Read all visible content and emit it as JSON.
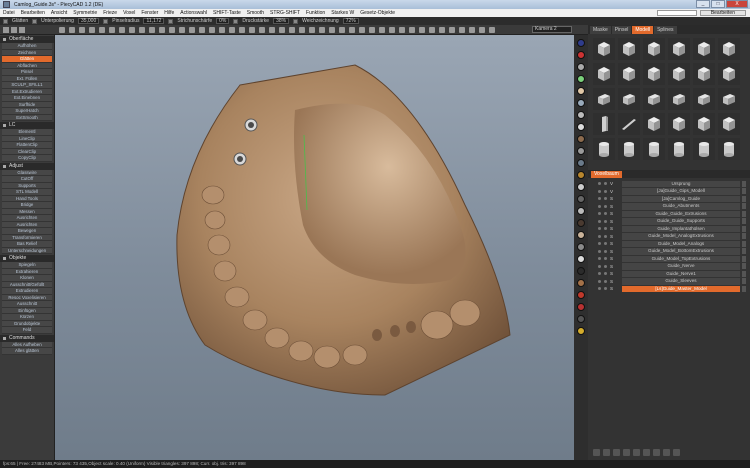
{
  "window": {
    "title": "Camlog_Guide.3s* - PiecyCAD 1.2 (DE)",
    "buttons": [
      "_",
      "□",
      "X"
    ]
  },
  "menubar": {
    "items": [
      "Datei",
      "Bearbeiten",
      "Ansicht",
      "Symmetrie",
      "Frieze",
      "Voxel",
      "Fenster",
      "Hilfe",
      "Actionswahl",
      "SHIFT-Taste",
      "Smooth",
      "STRG-SHIFT",
      "Funktion",
      "Starkes W",
      "Gesetz-Objekte"
    ],
    "right_button": "Bearbeiten"
  },
  "toolbar": {
    "label_left": "Glätten",
    "items": [
      {
        "label": "Unterpolierung",
        "value": "35,000"
      },
      {
        "label": "Pinselradius",
        "value": "11,172"
      },
      {
        "label": "Strichunschärfe",
        "value": "0%"
      },
      {
        "label": "Druckstärke",
        "value": "38%"
      },
      {
        "label": "Weichzeichnung",
        "value": "72%"
      }
    ]
  },
  "viewport": {
    "camera_select": "Kamera 2"
  },
  "left_panel": {
    "sections": [
      {
        "title": "Oberfläche",
        "items": [
          "Aufhöhen",
          "Zeichnen",
          "Glätten",
          "Abflachen",
          "Pinsel",
          "Ext. Füllen",
          "SCULP_SFILL1",
          "Ext.Extrudieren",
          "Ext.Einebnen",
          "Surfhide",
          "SuperHatch",
          "ExtSmooth"
        ],
        "active_index": 2
      },
      {
        "title": "LC",
        "items": [
          "Elementl",
          "LineClip",
          "FlattenClip",
          "ClearClip",
          "CopyClip"
        ]
      },
      {
        "title": "Adjust",
        "items": [
          "Glasswire",
          "CutOff",
          "Supports",
          "STL Modell",
          "Hand Tools",
          "Bridge",
          "Messen",
          "Ausrichten",
          "Ausrichten",
          "Bewegen",
          "Transformieren",
          "Bas Relief",
          "Unterschneidungen"
        ]
      },
      {
        "title": "Objekte",
        "items": [
          "Spiegeln",
          "Extrahieren",
          "Klonen",
          "Ausschnitt/Gefüllt",
          "Extrudieren",
          "Resoc Voxelisieren",
          "Ausschnitt",
          "Einfügen",
          "Kürzen",
          "Grundobjekte",
          "Feld"
        ]
      },
      {
        "title": "Commands",
        "items": [
          "Alles Aufheben",
          "Alles glätten"
        ]
      }
    ]
  },
  "right_panel": {
    "tabs": [
      "Maske",
      "Pinsel",
      "Modell",
      "Splines"
    ],
    "active_tab": 2,
    "scene_header": "Voxelbaum",
    "scene_items": [
      {
        "flag": "V",
        "label": "Ursprung"
      },
      {
        "flag": "V",
        "label": "[Ja]Guide_Gips_Modell"
      },
      {
        "flag": "S",
        "label": "[Ja]Camlog_Guide"
      },
      {
        "flag": "S",
        "label": "Guide_Abutments"
      },
      {
        "flag": "S",
        "label": "Guide_Guide_Extrusions"
      },
      {
        "flag": "S",
        "label": "Guide_Guide_Supports"
      },
      {
        "flag": "S",
        "label": "Guide_Implantathülsen"
      },
      {
        "flag": "S",
        "label": "Guide_Model_AnalogExtrusions"
      },
      {
        "flag": "S",
        "label": "Guide_Model_Analogs"
      },
      {
        "flag": "S",
        "label": "Guide_Model_BottomExtrusions"
      },
      {
        "flag": "S",
        "label": "Guide_Model_TopExtrusions"
      },
      {
        "flag": "S",
        "label": "Guide_Nerve"
      },
      {
        "flag": "S",
        "label": "Guide_Nerve1"
      },
      {
        "flag": "S",
        "label": "Guide_Sleeves"
      },
      {
        "flag": "S",
        "label": "[Ls]Guide_Master_Model"
      }
    ],
    "selected_index": 14
  },
  "status": {
    "text": "fps:65 | Free: 27483 MB,Pointers: 73 435,Object scale: 0.40 (Uniform) Visible triangles: 397 898; Curr. obj. tris: 397 898"
  },
  "colors": {
    "accent": "#e26a2c",
    "model": "#b08c6c"
  }
}
